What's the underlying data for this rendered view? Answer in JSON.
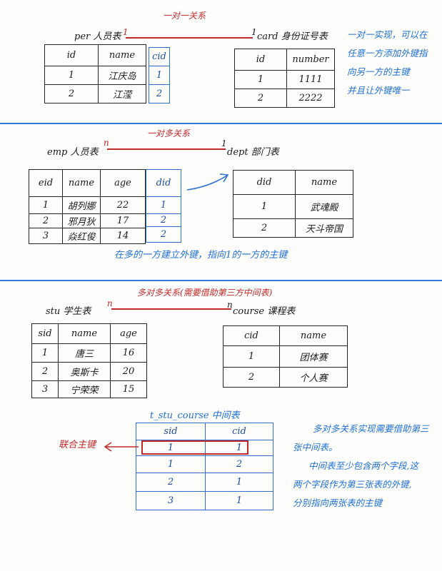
{
  "one_to_one": {
    "title": "一对一关系",
    "left_label": "per 人员表",
    "one_left": "1",
    "one_right": "1",
    "right_label": "card 身份证号表",
    "per_table": {
      "headers": [
        "id",
        "name"
      ],
      "rows": [
        [
          "1",
          "江庆岛"
        ],
        [
          "2",
          "江滢"
        ]
      ],
      "fk_header": "cid",
      "fk_values": [
        "1",
        "2"
      ]
    },
    "card_table": {
      "headers": [
        "id",
        "number"
      ],
      "rows": [
        [
          "1",
          "1111"
        ],
        [
          "2",
          "2222"
        ]
      ]
    },
    "note": [
      "一对一实现，可以在",
      "任意一方添加外键指",
      "向另一方的主键",
      "并且让外键唯一"
    ]
  },
  "one_to_many": {
    "title": "一对多关系",
    "left_label": "emp 人员表",
    "many": "n",
    "one": "1",
    "right_label": "dept 部门表",
    "emp_table": {
      "headers": [
        "eid",
        "name",
        "age"
      ],
      "rows": [
        [
          "1",
          "胡列娜",
          "22"
        ],
        [
          "2",
          "邪月狄",
          "17"
        ],
        [
          "3",
          "焱红俊",
          "14"
        ]
      ],
      "fk_header": "did",
      "fk_values": [
        "1",
        "2",
        "2"
      ]
    },
    "dept_table": {
      "headers": [
        "did",
        "name"
      ],
      "rows": [
        [
          "1",
          "武魂殿"
        ],
        [
          "2",
          "天斗帝国"
        ]
      ]
    },
    "note": "在多的一方建立外键，指向1的一方的主键"
  },
  "many_to_many": {
    "title": "多对多关系(需要借助第三方中间表)",
    "left_label": "stu 学生表",
    "many_left": "n",
    "many_right": "n",
    "right_label": "course 课程表",
    "stu_table": {
      "headers": [
        "sid",
        "name",
        "age"
      ],
      "rows": [
        [
          "1",
          "唐三",
          "16"
        ],
        [
          "2",
          "奥斯卡",
          "20"
        ],
        [
          "3",
          "宁荣荣",
          "15"
        ]
      ]
    },
    "course_table": {
      "headers": [
        "cid",
        "name"
      ],
      "rows": [
        [
          "1",
          "团体赛"
        ],
        [
          "2",
          "个人赛"
        ]
      ]
    },
    "mid_title": "t_stu_course 中间表",
    "mid_table": {
      "headers": [
        "sid",
        "cid"
      ],
      "rows": [
        [
          "1",
          "1"
        ],
        [
          "1",
          "2"
        ],
        [
          "2",
          "1"
        ],
        [
          "3",
          "1"
        ]
      ]
    },
    "composite_label": "联合主键",
    "note": [
      "多对多关系实现需要借助第三",
      "张中间表。",
      "中间表至少包含两个字段,这",
      "两个字段作为第三张表的外键,",
      "分别指向两张表的主键"
    ]
  },
  "colors": {
    "red": "#c0282a",
    "blue": "#1f6fd1",
    "ink": "#1a1a1a",
    "sep": "#2d7be0"
  }
}
